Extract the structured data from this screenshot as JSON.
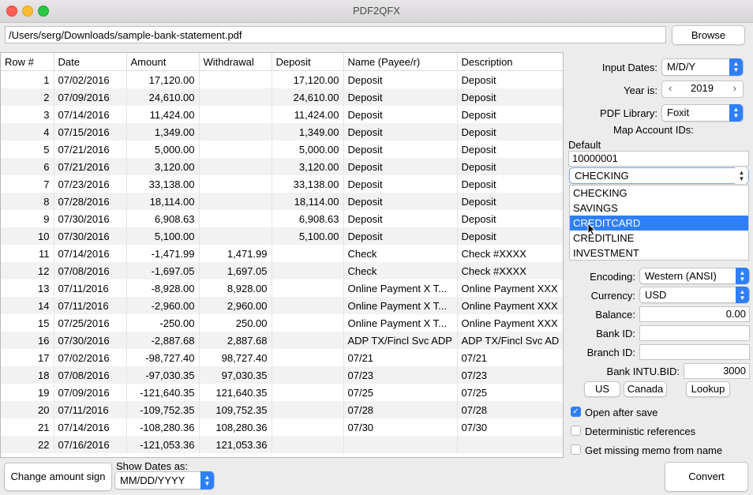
{
  "window": {
    "title": "PDF2QFX"
  },
  "file": {
    "path": "/Users/serg/Downloads/sample-bank-statement.pdf",
    "browse_label": "Browse"
  },
  "table": {
    "columns": [
      "Row #",
      "Date",
      "Amount",
      "Withdrawal",
      "Deposit",
      "Name (Payee/r)",
      "Description"
    ],
    "rows": [
      [
        "1",
        "07/02/2016",
        "17,120.00",
        "",
        "17,120.00",
        "Deposit",
        "Deposit"
      ],
      [
        "2",
        "07/09/2016",
        "24,610.00",
        "",
        "24,610.00",
        "Deposit",
        "Deposit"
      ],
      [
        "3",
        "07/14/2016",
        "11,424.00",
        "",
        "11,424.00",
        "Deposit",
        "Deposit"
      ],
      [
        "4",
        "07/15/2016",
        "1,349.00",
        "",
        "1,349.00",
        "Deposit",
        "Deposit"
      ],
      [
        "5",
        "07/21/2016",
        "5,000.00",
        "",
        "5,000.00",
        "Deposit",
        "Deposit"
      ],
      [
        "6",
        "07/21/2016",
        "3,120.00",
        "",
        "3,120.00",
        "Deposit",
        "Deposit"
      ],
      [
        "7",
        "07/23/2016",
        "33,138.00",
        "",
        "33,138.00",
        "Deposit",
        "Deposit"
      ],
      [
        "8",
        "07/28/2016",
        "18,114.00",
        "",
        "18,114.00",
        "Deposit",
        "Deposit"
      ],
      [
        "9",
        "07/30/2016",
        "6,908.63",
        "",
        "6,908.63",
        "Deposit",
        "Deposit"
      ],
      [
        "10",
        "07/30/2016",
        "5,100.00",
        "",
        "5,100.00",
        "Deposit",
        "Deposit"
      ],
      [
        "11",
        "07/14/2016",
        "-1,471.99",
        "1,471.99",
        "",
        "Check",
        "Check #XXXX"
      ],
      [
        "12",
        "07/08/2016",
        "-1,697.05",
        "1,697.05",
        "",
        "Check",
        "Check #XXXX"
      ],
      [
        "13",
        "07/11/2016",
        "-8,928.00",
        "8,928.00",
        "",
        "Online Payment X T...",
        "Online Payment XXX"
      ],
      [
        "14",
        "07/11/2016",
        "-2,960.00",
        "2,960.00",
        "",
        "Online Payment X T...",
        "Online Payment XXX"
      ],
      [
        "15",
        "07/25/2016",
        "-250.00",
        "250.00",
        "",
        "Online Payment X T...",
        "Online Payment XXX"
      ],
      [
        "16",
        "07/30/2016",
        "-2,887.68",
        "2,887.68",
        "",
        "ADP TX/Fincl Svc ADP",
        "ADP TX/Fincl Svc AD"
      ],
      [
        "17",
        "07/02/2016",
        "-98,727.40",
        "98,727.40",
        "",
        "07/21",
        "07/21"
      ],
      [
        "18",
        "07/08/2016",
        "-97,030.35",
        "97,030.35",
        "",
        "07/23",
        "07/23"
      ],
      [
        "19",
        "07/09/2016",
        "-121,640.35",
        "121,640.35",
        "",
        "07/25",
        "07/25"
      ],
      [
        "20",
        "07/11/2016",
        "-109,752.35",
        "109,752.35",
        "",
        "07/28",
        "07/28"
      ],
      [
        "21",
        "07/14/2016",
        "-108,280.36",
        "108,280.36",
        "",
        "07/30",
        "07/30"
      ],
      [
        "22",
        "07/16/2016",
        "-121,053.36",
        "121,053.36",
        "",
        "",
        ""
      ]
    ]
  },
  "bottom": {
    "change_sign_label": "Change amount sign",
    "show_dates_label": "Show Dates as:",
    "show_dates_value": "MM/DD/YYYY",
    "convert_label": "Convert"
  },
  "settings": {
    "input_dates_label": "Input Dates:",
    "input_dates_value": "M/D/Y",
    "year_label": "Year is:",
    "year_value": "2019",
    "pdf_library_label": "PDF Library:",
    "pdf_library_value": "Foxit",
    "map_accounts_label": "Map Account IDs:",
    "default_label": "Default",
    "account_id_value": "10000001",
    "account_type_value": "CHECKING",
    "account_type_options": [
      "CHECKING",
      "SAVINGS",
      "CREDITCARD",
      "CREDITLINE",
      "INVESTMENT"
    ],
    "account_type_highlighted": "CREDITCARD",
    "encoding_label": "Encoding:",
    "encoding_value": "Western (ANSI)",
    "currency_label": "Currency:",
    "currency_value": "USD",
    "balance_label": "Balance:",
    "balance_value": "0.00",
    "bank_id_label": "Bank ID:",
    "bank_id_value": "",
    "branch_id_label": "Branch ID:",
    "branch_id_value": "",
    "intu_bid_label": "Bank INTU.BID:",
    "intu_bid_value": "3000",
    "us_label": "US",
    "canada_label": "Canada",
    "lookup_label": "Lookup",
    "open_after_save_label": "Open after save",
    "open_after_save_checked": true,
    "deterministic_label": "Deterministic references",
    "deterministic_checked": false,
    "missing_memo_label": "Get missing memo from name",
    "missing_memo_checked": false
  },
  "colors": {
    "accent": "#2f7ffa",
    "close": "#fe5f57",
    "minimize": "#febc2e",
    "maximize": "#28c840"
  }
}
